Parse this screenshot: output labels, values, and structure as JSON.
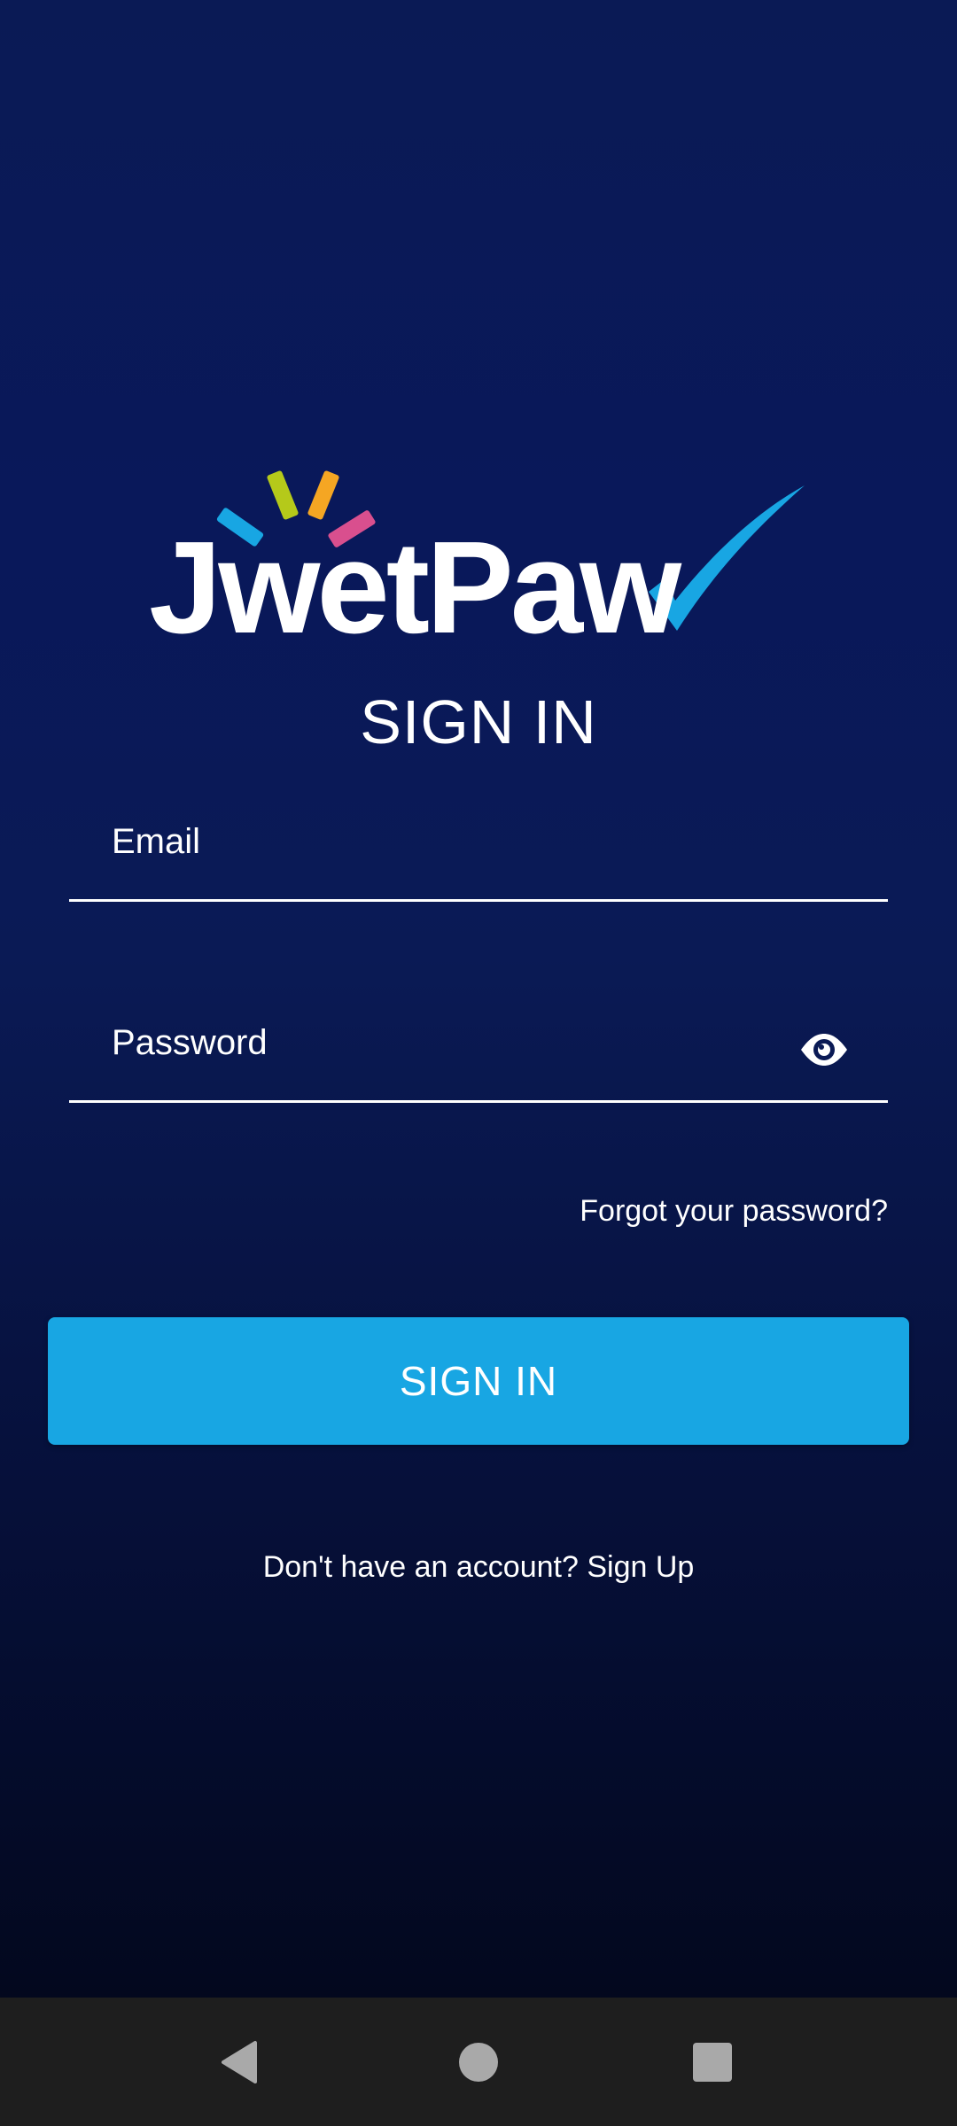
{
  "logo": {
    "text": "JwetPaw",
    "colors": {
      "ray_blue": "#18a6e3",
      "ray_green": "#b5c91a",
      "ray_orange": "#f5a623",
      "ray_pink": "#d94f8e",
      "check": "#18a6e3"
    }
  },
  "title": "SIGN IN",
  "email": {
    "placeholder": "Email"
  },
  "password": {
    "placeholder": "Password",
    "toggle_icon": "eye-icon"
  },
  "forgot_password": "Forgot your password?",
  "sign_in_button": "SIGN IN",
  "sign_up_prompt": "Don't have an account? Sign Up",
  "nav": {
    "back_icon": "back-triangle-icon",
    "home_icon": "home-circle-icon",
    "recent_icon": "recent-square-icon"
  },
  "colors": {
    "accent": "#18a6e3",
    "background_top": "#0a1a55",
    "background_bottom": "#020617",
    "navbar": "#1e1e1e"
  }
}
